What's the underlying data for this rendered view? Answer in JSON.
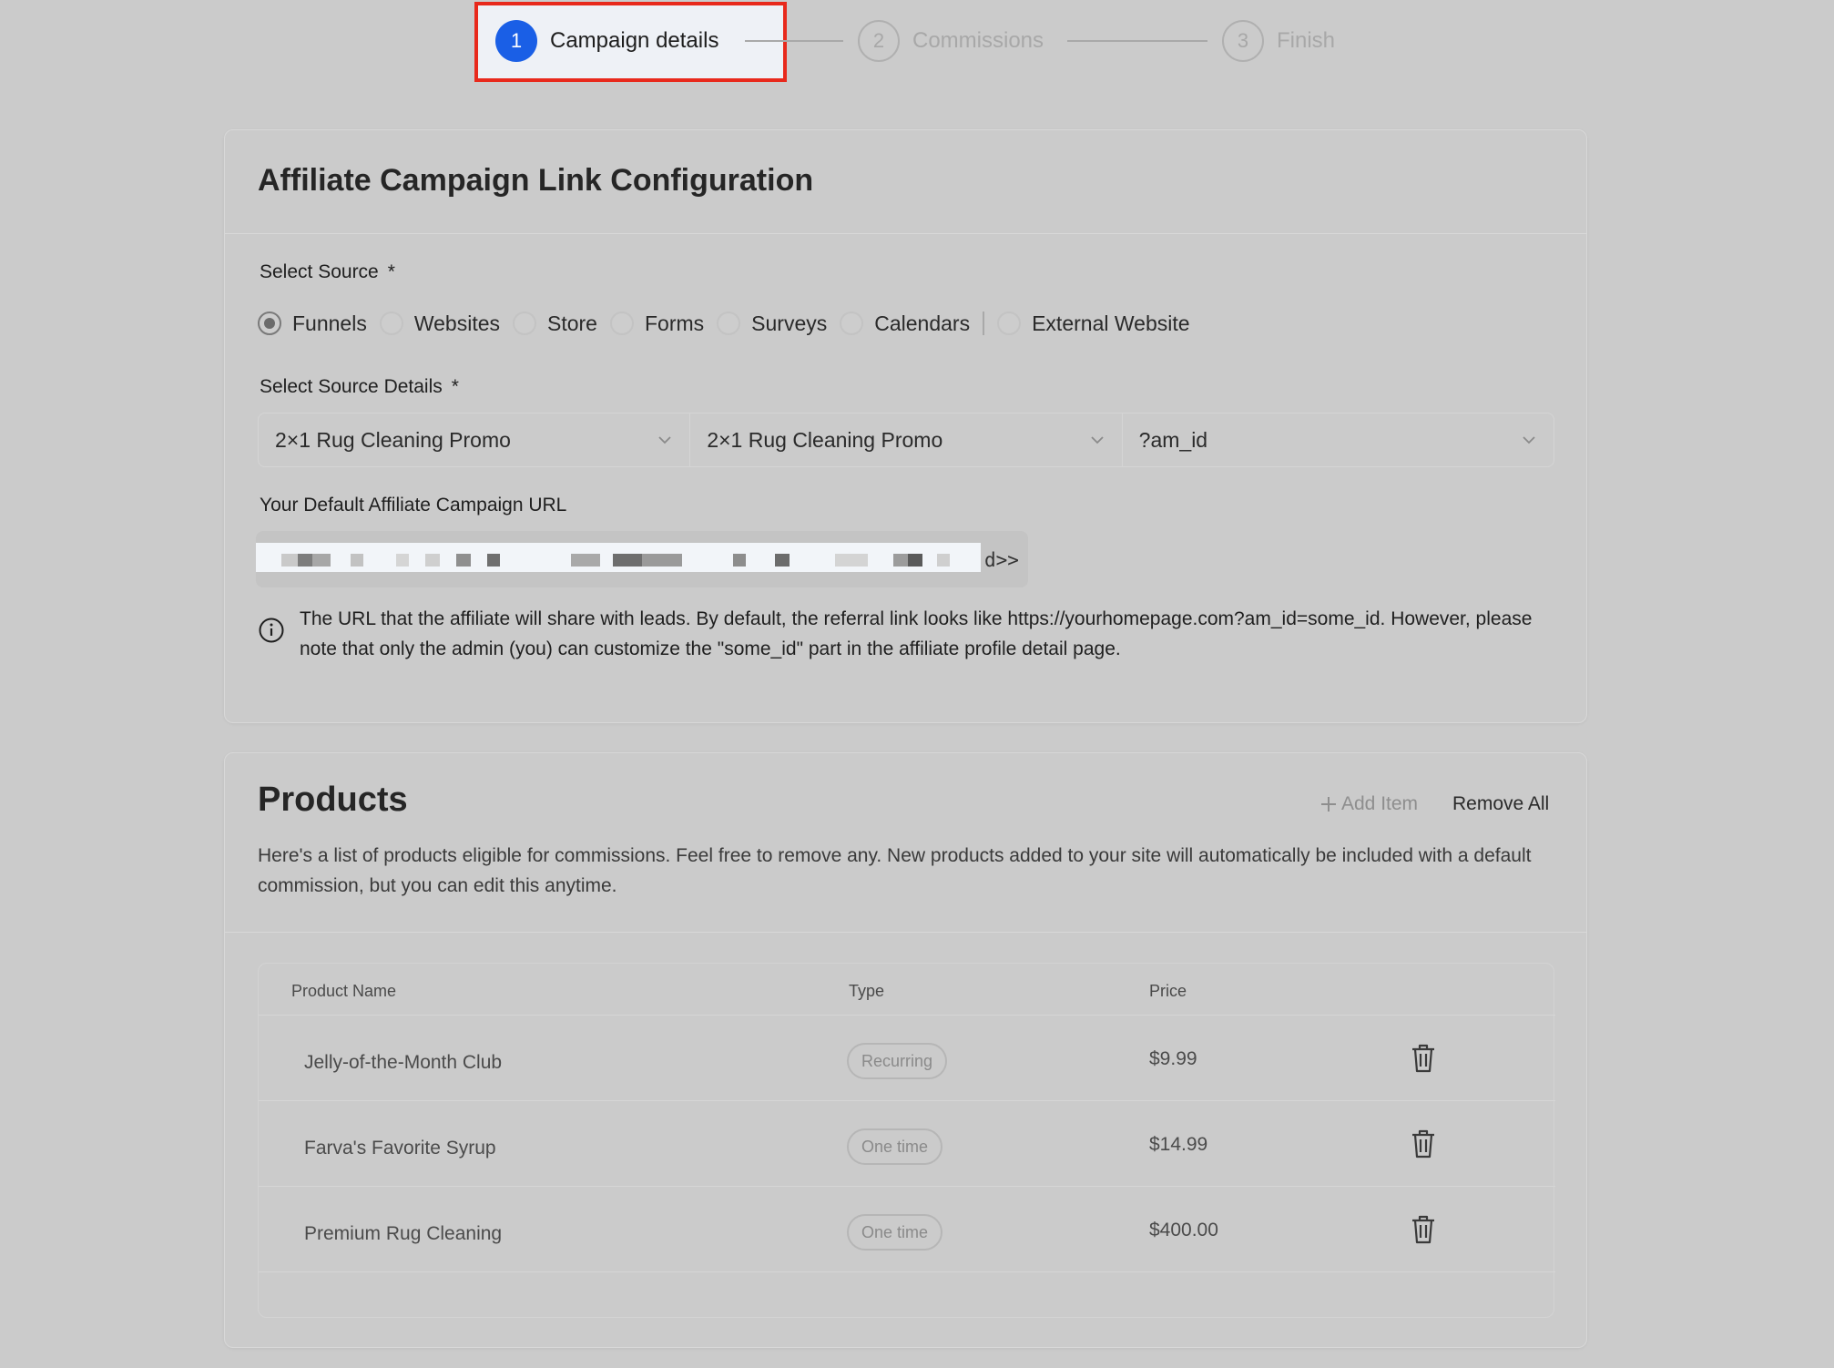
{
  "stepper": {
    "steps": [
      {
        "number": "1",
        "label": "Campaign details"
      },
      {
        "number": "2",
        "label": "Commissions"
      },
      {
        "number": "3",
        "label": "Finish"
      }
    ]
  },
  "link_config": {
    "title": "Affiliate Campaign Link Configuration",
    "source_label": "Select Source",
    "required_mark": "*",
    "sources": [
      "Funnels",
      "Websites",
      "Store",
      "Forms",
      "Surveys",
      "Calendars",
      "External Website"
    ],
    "selected_source": "Funnels",
    "details_label": "Select Source Details",
    "details": {
      "funnel": "2×1 Rug Cleaning Promo",
      "page": "2×1 Rug Cleaning Promo",
      "param": "?am_id"
    },
    "url_label": "Your Default Affiliate Campaign URL",
    "url_visible_suffix": "d>>",
    "info_text": "The URL that the affiliate will share with leads. By default, the referral link looks like https://yourhomepage.com?am_id=some_id. However, please note that only the admin (you) can customize the \"some_id\" part in the affiliate profile detail page."
  },
  "products": {
    "title": "Products",
    "add_item": "Add Item",
    "remove_all": "Remove All",
    "description": "Here's a list of products eligible for commissions. Feel free to remove any. New products added to your site will automatically be included with a default commission, but you can edit this anytime.",
    "columns": {
      "name": "Product Name",
      "type": "Type",
      "price": "Price"
    },
    "rows": [
      {
        "name": "Jelly-of-the-Month Club",
        "type": "Recurring",
        "price": "$9.99"
      },
      {
        "name": "Farva's Favorite Syrup",
        "type": "One time",
        "price": "$14.99"
      },
      {
        "name": "Premium Rug Cleaning",
        "type": "One time",
        "price": "$400.00"
      }
    ]
  },
  "colors": {
    "accent": "#1a5fe6",
    "highlight": "#e8291c",
    "background": "#cbcbcb"
  }
}
